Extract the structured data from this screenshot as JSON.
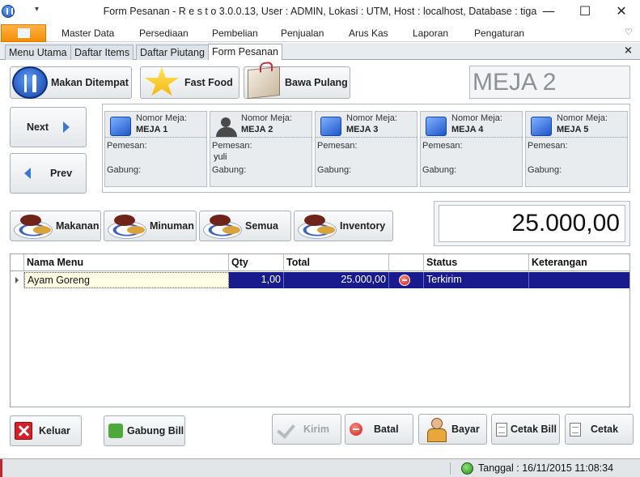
{
  "window": {
    "title": "Form Pesanan - R e s t o 3.0.0.13,  User : ADMIN, Lokasi : UTM, Host : localhost, Database : tiga",
    "minimize_glyph": "—",
    "maximize_glyph": "☐",
    "close_glyph": "✕",
    "qa_glyph": "▾"
  },
  "ribbon": {
    "menu": [
      "Master Data",
      "Persediaan",
      "Pembelian",
      "Penjualan",
      "Arus Kas",
      "Laporan",
      "Pengaturan"
    ],
    "toggle_glyph": "♡"
  },
  "tabs": [
    "Menu Utama",
    "Daftar Items",
    "Daftar Piutang",
    "Form Pesanan"
  ],
  "tab_close_glyph": "×",
  "order_types": [
    "Makan Ditempat",
    "Fast Food",
    "Bawa Pulang"
  ],
  "selected_table": "MEJA 2",
  "nav": {
    "next": "Next",
    "prev": "Prev"
  },
  "tables": [
    {
      "nomor_label": "Nomor Meja:",
      "name": "MEJA 1",
      "pemesan_label": "Pemesan:",
      "pemesan": "",
      "gabung_label": "Gabung:"
    },
    {
      "nomor_label": "Nomor Meja:",
      "name": "MEJA 2",
      "pemesan_label": "Pemesan:",
      "pemesan": "yuli",
      "gabung_label": "Gabung:"
    },
    {
      "nomor_label": "Nomor Meja:",
      "name": "MEJA 3",
      "pemesan_label": "Pemesan:",
      "pemesan": "",
      "gabung_label": "Gabung:"
    },
    {
      "nomor_label": "Nomor Meja:",
      "name": "MEJA 4",
      "pemesan_label": "Pemesan:",
      "pemesan": "",
      "gabung_label": "Gabung:"
    },
    {
      "nomor_label": "Nomor Meja:",
      "name": "MEJA 5",
      "pemesan_label": "Pemesan:",
      "pemesan": "",
      "gabung_label": "Gabung:"
    }
  ],
  "categories": [
    "Makanan",
    "Minuman",
    "Semua",
    "Inventory"
  ],
  "total": "25.000,00",
  "grid": {
    "columns": [
      "Nama Menu",
      "Qty",
      "Total",
      "",
      "Status",
      "Keterangan"
    ],
    "rows": [
      {
        "nama": "Ayam Goreng",
        "qty": "1,00",
        "total": "25.000,00",
        "status": "Terkirim",
        "keterangan": ""
      }
    ]
  },
  "actions": {
    "keluar": "Keluar",
    "gabung_bill": "Gabung Bill",
    "kirim": "Kirim",
    "batal": "Batal",
    "bayar": "Bayar",
    "cetak_bill": "Cetak Bill",
    "cetak": "Cetak"
  },
  "status_bar": {
    "tanggal": "Tanggal : 16/11/2015 11:08:34"
  },
  "colors": {
    "row_selected": "#1a1a8f",
    "app_menu": "#f58d00",
    "accent": "#3a78d6"
  }
}
